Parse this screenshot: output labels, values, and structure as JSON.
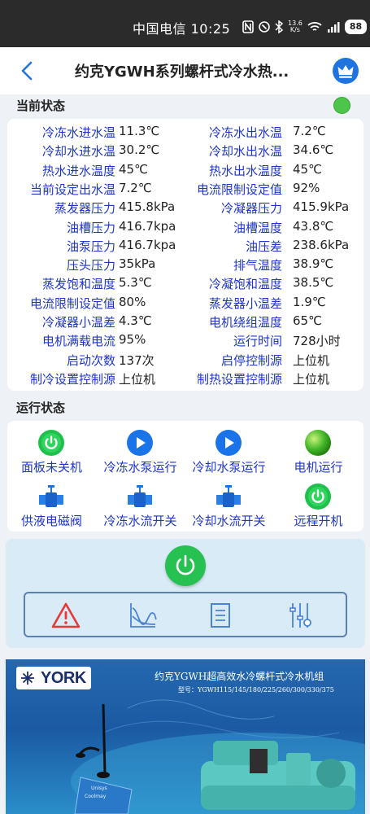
{
  "status_bar": {
    "carrier_time": "中国电信 10:25",
    "net_speed_value": "13.6",
    "net_speed_unit": "K/s",
    "battery": "88",
    "icons": [
      "nfc-icon",
      "vibrate-icon",
      "bluetooth-icon",
      "netspeed-icon",
      "wifi-icon",
      "signal-icon",
      "battery-icon"
    ]
  },
  "header": {
    "title": "约克YGWH系列螺杆式冷水热...",
    "back_icon": "chevron-left-icon",
    "crown_icon": "crown-icon"
  },
  "current_status": {
    "section_title": "当前状态",
    "indicator_color": "#4dc44a",
    "rows": [
      {
        "l1": "冷冻水进水温",
        "v1": "11.3℃",
        "l2": "冷冻水出水温",
        "v2": "7.2℃"
      },
      {
        "l1": "冷却水进水温",
        "v1": "30.2℃",
        "l2": "冷却水出水温",
        "v2": "34.6℃"
      },
      {
        "l1": "热水进水温度",
        "v1": "45℃",
        "l2": "热水出水温度",
        "v2": "45℃"
      },
      {
        "l1": "当前设定出水温",
        "v1": "7.2℃",
        "l2": "电流限制设定值",
        "v2": "92%"
      },
      {
        "l1": "蒸发器压力",
        "v1": "415.8kPa",
        "l2": "冷凝器压力",
        "v2": "415.9kPa"
      },
      {
        "l1": "油槽压力",
        "v1": "416.7kpa",
        "l2": "油槽温度",
        "v2": "43.8℃"
      },
      {
        "l1": "油泵压力",
        "v1": "416.7kpa",
        "l2": "油压差",
        "v2": "238.6kPa"
      },
      {
        "l1": "压头压力",
        "v1": "35kPa",
        "l2": "排气温度",
        "v2": "38.9℃"
      },
      {
        "l1": "蒸发饱和温度",
        "v1": "5.3℃",
        "l2": "冷凝饱和温度",
        "v2": "38.5℃"
      },
      {
        "l1": "电流限制设定值",
        "v1": "80%",
        "l2": "蒸发器小温差",
        "v2": "1.9℃"
      },
      {
        "l1": "冷凝器小温差",
        "v1": "4.3℃",
        "l2": "电机绕组温度",
        "v2": "65℃"
      },
      {
        "l1": "电机满载电流",
        "v1": "95%",
        "l2": "运行时间",
        "v2": "728小时"
      },
      {
        "l1": "启动次数",
        "v1": "137次",
        "l2": "启停控制源",
        "v2": "上位机"
      },
      {
        "l1": "制冷设置控制源",
        "v1": "上位机",
        "l2": "制热设置控制源",
        "v2": "上位机"
      }
    ]
  },
  "run_status": {
    "section_title": "运行状态",
    "items": [
      {
        "label": "面板未关机",
        "icon": "power-green-icon"
      },
      {
        "label": "冷冻水泵运行",
        "icon": "play-blue-icon"
      },
      {
        "label": "冷却水泵运行",
        "icon": "play-blue-icon"
      },
      {
        "label": "电机运行",
        "icon": "green-ball-icon"
      },
      {
        "label": "供液电磁阀",
        "icon": "valve-blue-icon"
      },
      {
        "label": "冷冻水流开关",
        "icon": "valve-blue-icon"
      },
      {
        "label": "冷却水流开关",
        "icon": "valve-blue-icon"
      },
      {
        "label": "远程开机",
        "icon": "power-green-icon"
      }
    ]
  },
  "controls": {
    "power_icon": "power-button-icon",
    "tools": [
      "alarm-icon",
      "trend-chart-icon",
      "list-icon",
      "settings-sliders-icon"
    ]
  },
  "banner": {
    "logo_text": "YORK",
    "title": "约克YGWH超高效水冷螺杆式冷水机组",
    "model": "型号：YGWH115/145/180/225/260/300/330/375",
    "device_label": "Unisys",
    "gateway_text": "Coolmay"
  },
  "colors": {
    "label_blue": "#1f36c9",
    "accent_blue": "#1f74e0",
    "green": "#27c152"
  }
}
